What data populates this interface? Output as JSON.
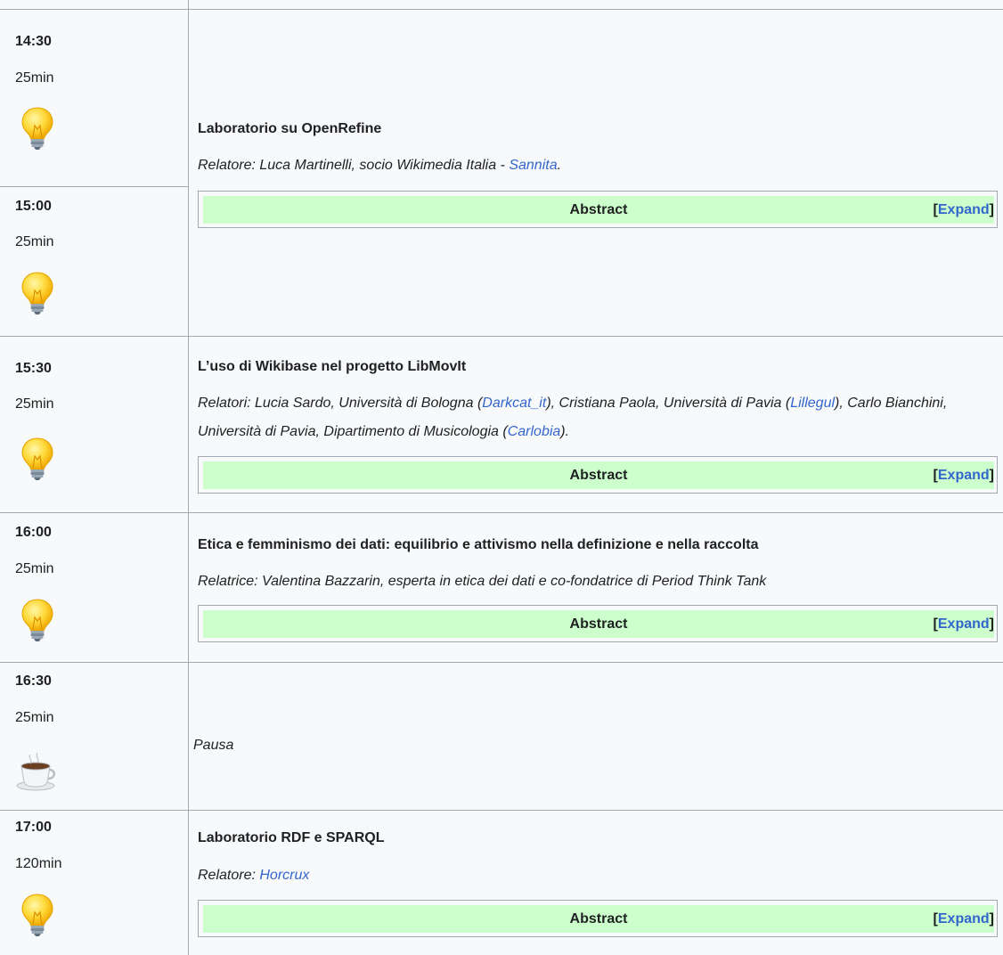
{
  "slots": [
    {
      "time": "14:30",
      "duration": "25min",
      "icon": "lightbulb-icon"
    },
    {
      "time": "15:00",
      "duration": "25min",
      "icon": "lightbulb-icon"
    },
    {
      "time": "15:30",
      "duration": "25min",
      "icon": "lightbulb-icon"
    },
    {
      "time": "16:00",
      "duration": "25min",
      "icon": "lightbulb-icon"
    },
    {
      "time": "16:30",
      "duration": "25min",
      "icon": "coffee-cup-icon"
    },
    {
      "time": "17:00",
      "duration": "120min",
      "icon": "lightbulb-icon"
    }
  ],
  "events": [
    {
      "title": "Laboratorio su OpenRefine",
      "speakers_prefix": "Relatore: Luca Martinelli, socio Wikimedia Italia - ",
      "speaker_link": "Sannita",
      "speakers_suffix": ".",
      "abstract_label": "Abstract",
      "expand_label": "Expand"
    },
    {
      "title": "L’uso di Wikibase nel progetto LibMovIt",
      "speakers_part1": "Relatori: Lucia Sardo, Università di Bologna (",
      "link1": "Darkcat_it",
      "speakers_part2": "), Cristiana Paola, Università di Pavia (",
      "link2": "Lillegul",
      "speakers_part3": "), Carlo Bianchini, Università di Pavia, Dipartimento di Musicologia (",
      "link3": "Carlobia",
      "speakers_part4": ").",
      "abstract_label": "Abstract",
      "expand_label": "Expand"
    },
    {
      "title": "Etica e femminismo dei dati: equilibrio e attivismo nella definizione e nella raccolta",
      "speakers": "Relatrice: Valentina Bazzarin, esperta in etica dei dati e co-fondatrice di Period Think Tank",
      "abstract_label": "Abstract",
      "expand_label": "Expand"
    },
    {
      "pause": "Pausa"
    },
    {
      "title": "Laboratorio RDF e SPARQL",
      "speakers_prefix": "Relatore: ",
      "speaker_link": "Horcrux",
      "abstract_label": "Abstract",
      "expand_label": "Expand"
    }
  ],
  "brackets": {
    "open": "[",
    "close": "]"
  },
  "colors": {
    "link": "#3366cc",
    "abstract_bar": "#ccffcc",
    "border": "#a2a9b1",
    "background": "#f8f9fa"
  }
}
